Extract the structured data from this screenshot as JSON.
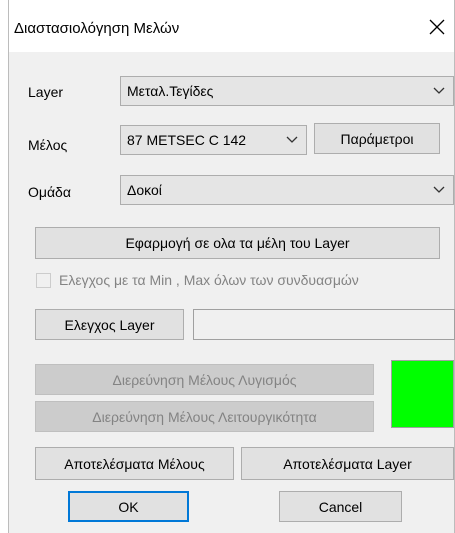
{
  "window": {
    "title": "Διαστασιολόγηση Μελών"
  },
  "form": {
    "layer_label": "Layer",
    "layer_value": "Μεταλ.Τεγίδες",
    "member_label": "Μέλος",
    "member_value": "87 METSEC C 142",
    "parameters_button": "Παράμετροι",
    "group_label": "Ομάδα",
    "group_value": "Δοκοί",
    "apply_all_button": "Εφαρμογή σε ολα τα μέλη του Layer",
    "minmax_checkbox_label": "Ελεγχος με τα Min , Max όλων των συνδυασμών",
    "minmax_checked": false,
    "check_layer_button": "Ελεγχος Layer",
    "check_layer_text": "",
    "buckling_button": "Διερεύνηση Μέλους Λυγισμός",
    "serviceability_button": "Διερεύνηση Μέλους Λειτουργικότητα",
    "status_color": "#00ff00",
    "member_results_button": "Αποτελέσματα Μέλους",
    "layer_results_button": "Αποτελέσματα Layer",
    "ok_button": "OK",
    "cancel_button": "Cancel"
  },
  "icons": {
    "close": "close-icon",
    "dropdown": "chevron-down-icon"
  }
}
